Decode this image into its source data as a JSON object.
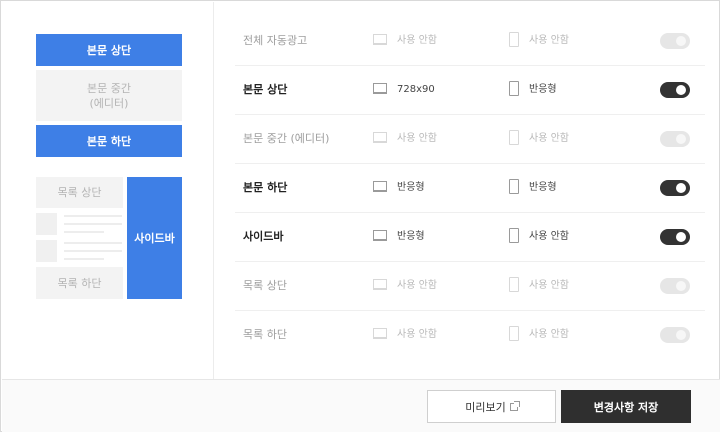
{
  "preview": {
    "body_top": "본문 상단",
    "body_middle_line1": "본문 중간",
    "body_middle_line2": "(에디터)",
    "body_bottom": "본문 하단",
    "list_top": "목록 상단",
    "list_bottom": "목록 하단",
    "sidebar": "사이드바"
  },
  "rows": [
    {
      "name": "전체 자동광고",
      "pc": "사용 안함",
      "mobile": "사용 안함",
      "enabled": false
    },
    {
      "name": "본문 상단",
      "pc": "728x90",
      "mobile": "반응형",
      "enabled": true
    },
    {
      "name": "본문 중간 (에디터)",
      "pc": "사용 안함",
      "mobile": "사용 안함",
      "enabled": false
    },
    {
      "name": "본문 하단",
      "pc": "반응형",
      "mobile": "반응형",
      "enabled": true
    },
    {
      "name": "사이드바",
      "pc": "반응형",
      "mobile": "사용 안함",
      "enabled": true
    },
    {
      "name": "목록 상단",
      "pc": "사용 안함",
      "mobile": "사용 안함",
      "enabled": false
    },
    {
      "name": "목록 하단",
      "pc": "사용 안함",
      "mobile": "사용 안함",
      "enabled": false
    }
  ],
  "footer": {
    "preview_label": "미리보기",
    "save_label": "변경사항 저장"
  },
  "colors": {
    "accent_blue": "#3e7fe6",
    "toggle_on": "#333333",
    "toggle_off": "#e6e6e6",
    "save_button": "#2f2f2f"
  }
}
